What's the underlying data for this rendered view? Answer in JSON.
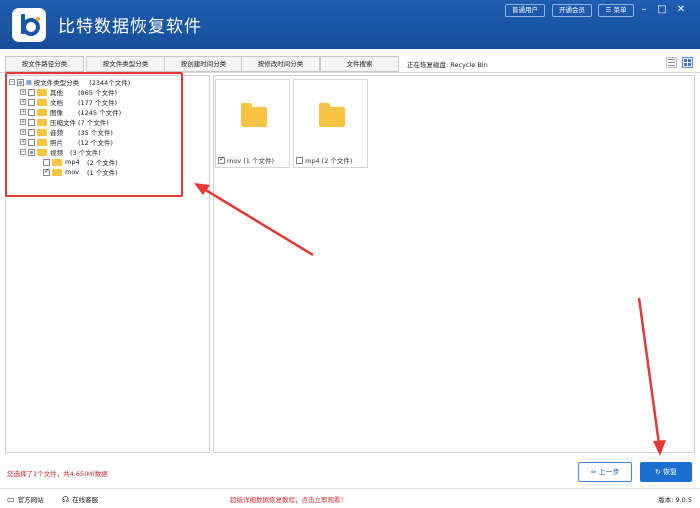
{
  "header": {
    "app_title": "比特数据恢复软件",
    "btn_normal_user": "普通用户",
    "btn_vip": "开通会员",
    "btn_menu": "菜单",
    "brand_color": "#1a56a8"
  },
  "tabs": [
    {
      "label": "按文件路径分类"
    },
    {
      "label": "按文件类型分类"
    },
    {
      "label": "按创建时间分类"
    },
    {
      "label": "按修改时间分类"
    },
    {
      "label": "文件搜索"
    }
  ],
  "disk_label": "正在恢复磁盘: Recycle Bin",
  "tree": [
    {
      "label": "按文件类型分类",
      "count": "(2344个文件)"
    },
    {
      "label": "其他",
      "count": "(865 个文件)"
    },
    {
      "label": "文档",
      "count": "(177 个文件)"
    },
    {
      "label": "图像",
      "count": "(1245 个文件)"
    },
    {
      "label": "压缩文件",
      "count": "(7 个文件)"
    },
    {
      "label": "音频",
      "count": "(35 个文件)"
    },
    {
      "label": "照片",
      "count": "(12 个文件)"
    },
    {
      "label": "视频",
      "count": "(3 个文件)"
    },
    {
      "label": "mp4",
      "count": "(2 个文件)"
    },
    {
      "label": "mov",
      "count": "(1 个文件)"
    }
  ],
  "cards": [
    {
      "label": "mov (1 个文件)",
      "checked": true
    },
    {
      "label": "mp4 (2 个文件)",
      "checked": false
    }
  ],
  "status_text": "您选择了1个文件，共4.65(M)数据",
  "btn_prev": "上一步",
  "btn_recover": "恢复",
  "footer": {
    "official_site": "官方网站",
    "online_service": "在线客服",
    "promo": "超级详细数据恢复教程，点击立即观看！",
    "version": "版本: 9.0.5"
  },
  "colors": {
    "highlight": "#e53935",
    "accent": "#1a6fd0"
  }
}
